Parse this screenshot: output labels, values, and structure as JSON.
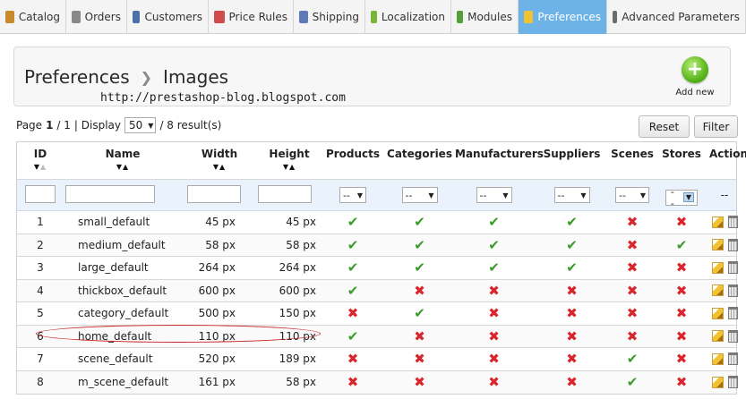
{
  "tabs": [
    {
      "label": "Catalog",
      "icon": "catalog-icon",
      "color": "#c98a2c",
      "width": 74
    },
    {
      "label": "Orders",
      "icon": "cart-icon",
      "color": "#888888",
      "width": 68
    },
    {
      "label": "Customers",
      "icon": "user-icon",
      "color": "#4d6fa8",
      "width": 91
    },
    {
      "label": "Price Rules",
      "icon": "price-rules-icon",
      "color": "#d04c4c",
      "width": 95
    },
    {
      "label": "Shipping",
      "icon": "truck-icon",
      "color": "#5d79b8",
      "width": 80
    },
    {
      "label": "Localization",
      "icon": "globe-icon",
      "color": "#7bb536",
      "width": 96
    },
    {
      "label": "Modules",
      "icon": "puzzle-icon",
      "color": "#53a03a",
      "width": 75
    },
    {
      "label": "Preferences",
      "icon": "preferences-icon",
      "color": "#f1c232",
      "width": 99,
      "active": true
    },
    {
      "label": "Advanced Parameters",
      "icon": "wrench-icon",
      "color": "#6c6c6c",
      "width": 155
    }
  ],
  "header": {
    "breadcrumb_parent": "Preferences",
    "breadcrumb_current": "Images",
    "watermark": "http://prestashop-blog.blogspot.com",
    "add_new_label": "Add new"
  },
  "pager": {
    "page_label": "Page",
    "page_current": "1",
    "page_total": "/ 1",
    "display_label": "| Display",
    "display_value": "50",
    "results": "/ 8 result(s)"
  },
  "buttons": {
    "reset": "Reset",
    "filter": "Filter"
  },
  "columns": {
    "id": "ID",
    "name": "Name",
    "width": "Width",
    "height": "Height",
    "products": "Products",
    "categories": "Categories",
    "manufacturers": "Manufacturers",
    "suppliers": "Suppliers",
    "scenes": "Scenes",
    "stores": "Stores",
    "actions": "Actions"
  },
  "filter_select_value": "--",
  "filter_actions_value": "--",
  "rows": [
    {
      "id": "1",
      "name": "small_default",
      "width": "45 px",
      "height": "45 px",
      "products": true,
      "categories": true,
      "manufacturers": true,
      "suppliers": true,
      "scenes": false,
      "stores": false
    },
    {
      "id": "2",
      "name": "medium_default",
      "width": "58 px",
      "height": "58 px",
      "products": true,
      "categories": true,
      "manufacturers": true,
      "suppliers": true,
      "scenes": false,
      "stores": true
    },
    {
      "id": "3",
      "name": "large_default",
      "width": "264 px",
      "height": "264 px",
      "products": true,
      "categories": true,
      "manufacturers": true,
      "suppliers": true,
      "scenes": false,
      "stores": false
    },
    {
      "id": "4",
      "name": "thickbox_default",
      "width": "600 px",
      "height": "600 px",
      "products": true,
      "categories": false,
      "manufacturers": false,
      "suppliers": false,
      "scenes": false,
      "stores": false
    },
    {
      "id": "5",
      "name": "category_default",
      "width": "500 px",
      "height": "150 px",
      "products": false,
      "categories": true,
      "manufacturers": false,
      "suppliers": false,
      "scenes": false,
      "stores": false
    },
    {
      "id": "6",
      "name": "home_default",
      "width": "110 px",
      "height": "110 px",
      "products": true,
      "categories": false,
      "manufacturers": false,
      "suppliers": false,
      "scenes": false,
      "stores": false
    },
    {
      "id": "7",
      "name": "scene_default",
      "width": "520 px",
      "height": "189 px",
      "products": false,
      "categories": false,
      "manufacturers": false,
      "suppliers": false,
      "scenes": true,
      "stores": false
    },
    {
      "id": "8",
      "name": "m_scene_default",
      "width": "161 px",
      "height": "58 px",
      "products": false,
      "categories": false,
      "manufacturers": false,
      "suppliers": false,
      "scenes": true,
      "stores": false
    }
  ],
  "colors": {
    "check": "#3a9b2a",
    "cross": "#d9262c",
    "active_tab": "#6eb3e8",
    "highlight_ellipse": "#c82020"
  }
}
